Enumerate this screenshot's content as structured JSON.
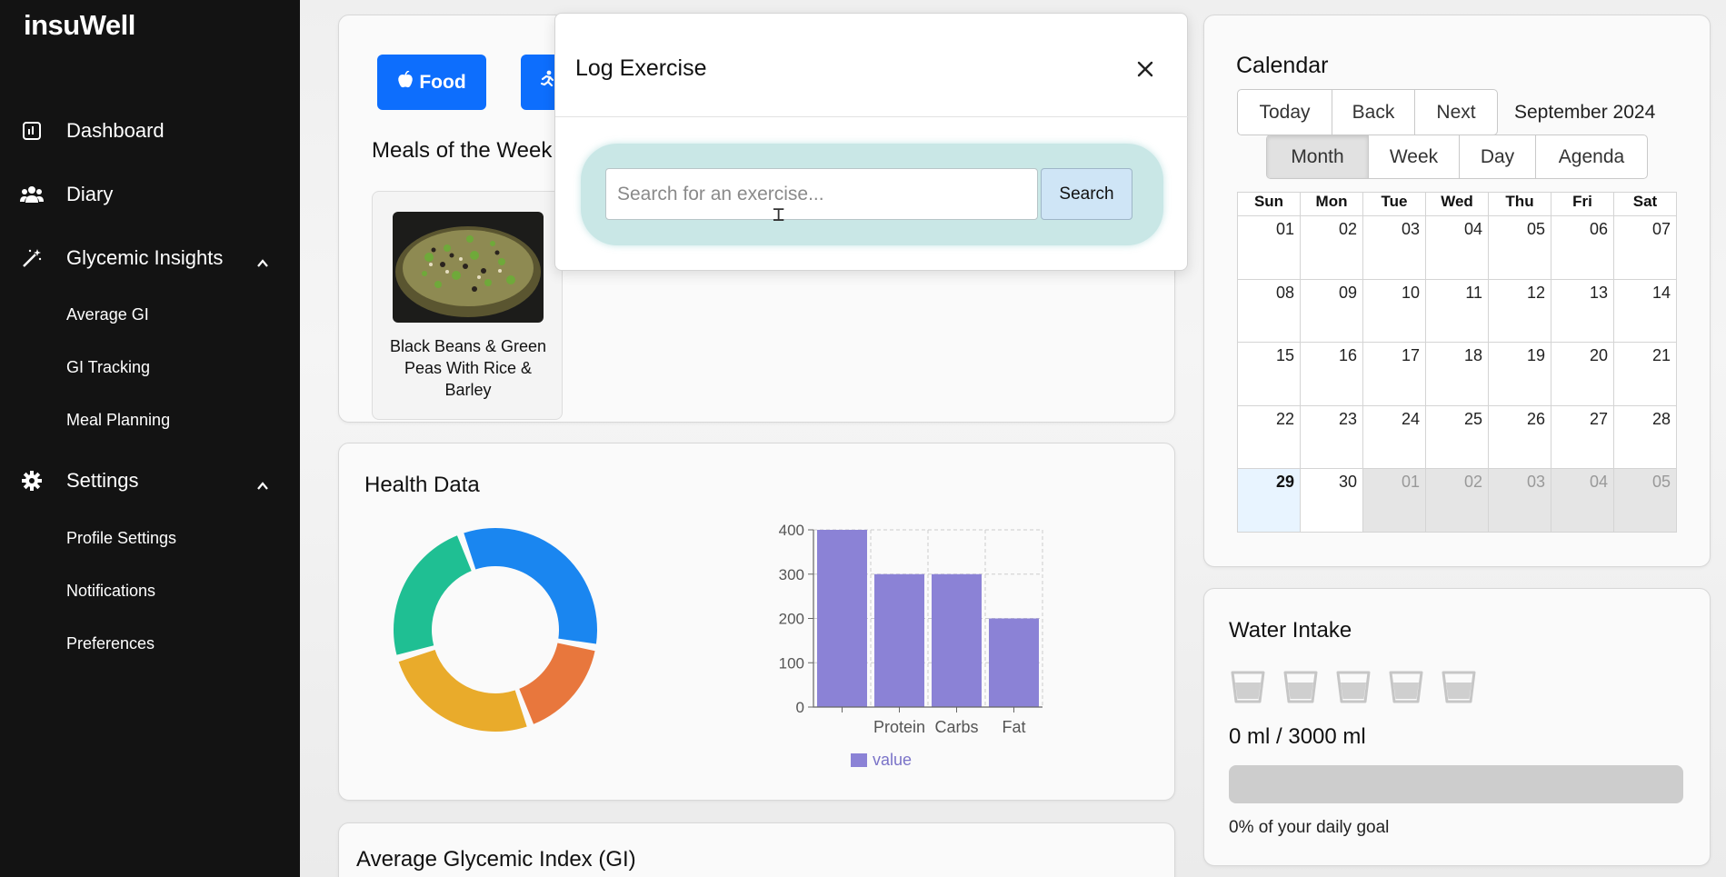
{
  "app": {
    "brand": "insuWell"
  },
  "sidebar": {
    "items": [
      {
        "label": "Dashboard",
        "icon": "dashboard-icon"
      },
      {
        "label": "Diary",
        "icon": "users-icon"
      },
      {
        "label": "Glycemic Insights",
        "icon": "magic-wand-icon",
        "expanded": true,
        "children": [
          "Average GI",
          "GI Tracking",
          "Meal Planning"
        ]
      },
      {
        "label": "Settings",
        "icon": "gear-icon",
        "expanded": true,
        "children": [
          "Profile Settings",
          "Notifications",
          "Preferences"
        ]
      }
    ]
  },
  "main": {
    "buttons": {
      "food": "Food",
      "food_icon": "apple-icon",
      "exercise_icon": "running-icon"
    },
    "meals_title": "Meals of the Week",
    "meals": [
      {
        "name": "Black Beans & Green Peas With Rice & Barley"
      }
    ]
  },
  "modal": {
    "title": "Log Exercise",
    "search": {
      "placeholder": "Search for an exercise...",
      "value": "",
      "button": "Search"
    }
  },
  "health": {
    "title": "Health Data",
    "donut": {
      "segments": [
        {
          "value": 32,
          "color": "#1a86f0"
        },
        {
          "value": 16,
          "color": "#e8773d"
        },
        {
          "value": 25,
          "color": "#e9ab2b"
        },
        {
          "value": 23,
          "color": "#1fbf93"
        }
      ]
    },
    "chart_data": {
      "type": "bar",
      "categories": [
        "",
        "Protein",
        "Carbs",
        "Fat"
      ],
      "values": [
        400,
        300,
        300,
        200
      ],
      "ylim": [
        0,
        400
      ],
      "yticks": [
        "0",
        "100",
        "200",
        "300",
        "400"
      ],
      "legend": "value",
      "grid": true,
      "bar_color": "#8b82d6"
    }
  },
  "gi": {
    "title": "Average Glycemic Index (GI)"
  },
  "calendar": {
    "title": "Calendar",
    "nav": [
      "Today",
      "Back",
      "Next"
    ],
    "label": "September 2024",
    "views": [
      "Month",
      "Week",
      "Day",
      "Agenda"
    ],
    "active_view": "Month",
    "days": [
      "Sun",
      "Mon",
      "Tue",
      "Wed",
      "Thu",
      "Fri",
      "Sat"
    ],
    "weeks": [
      [
        "01",
        "02",
        "03",
        "04",
        "05",
        "06",
        "07"
      ],
      [
        "08",
        "09",
        "10",
        "11",
        "12",
        "13",
        "14"
      ],
      [
        "15",
        "16",
        "17",
        "18",
        "19",
        "20",
        "21"
      ],
      [
        "22",
        "23",
        "24",
        "25",
        "26",
        "27",
        "28"
      ],
      [
        "29",
        "30",
        "01",
        "02",
        "03",
        "04",
        "05"
      ]
    ]
  },
  "water": {
    "title": "Water Intake",
    "amount": "0 ml / 3000 ml",
    "goal_text": "0% of your daily goal",
    "progress": 0,
    "cups": 5,
    "cup_icon": "cup-icon"
  }
}
